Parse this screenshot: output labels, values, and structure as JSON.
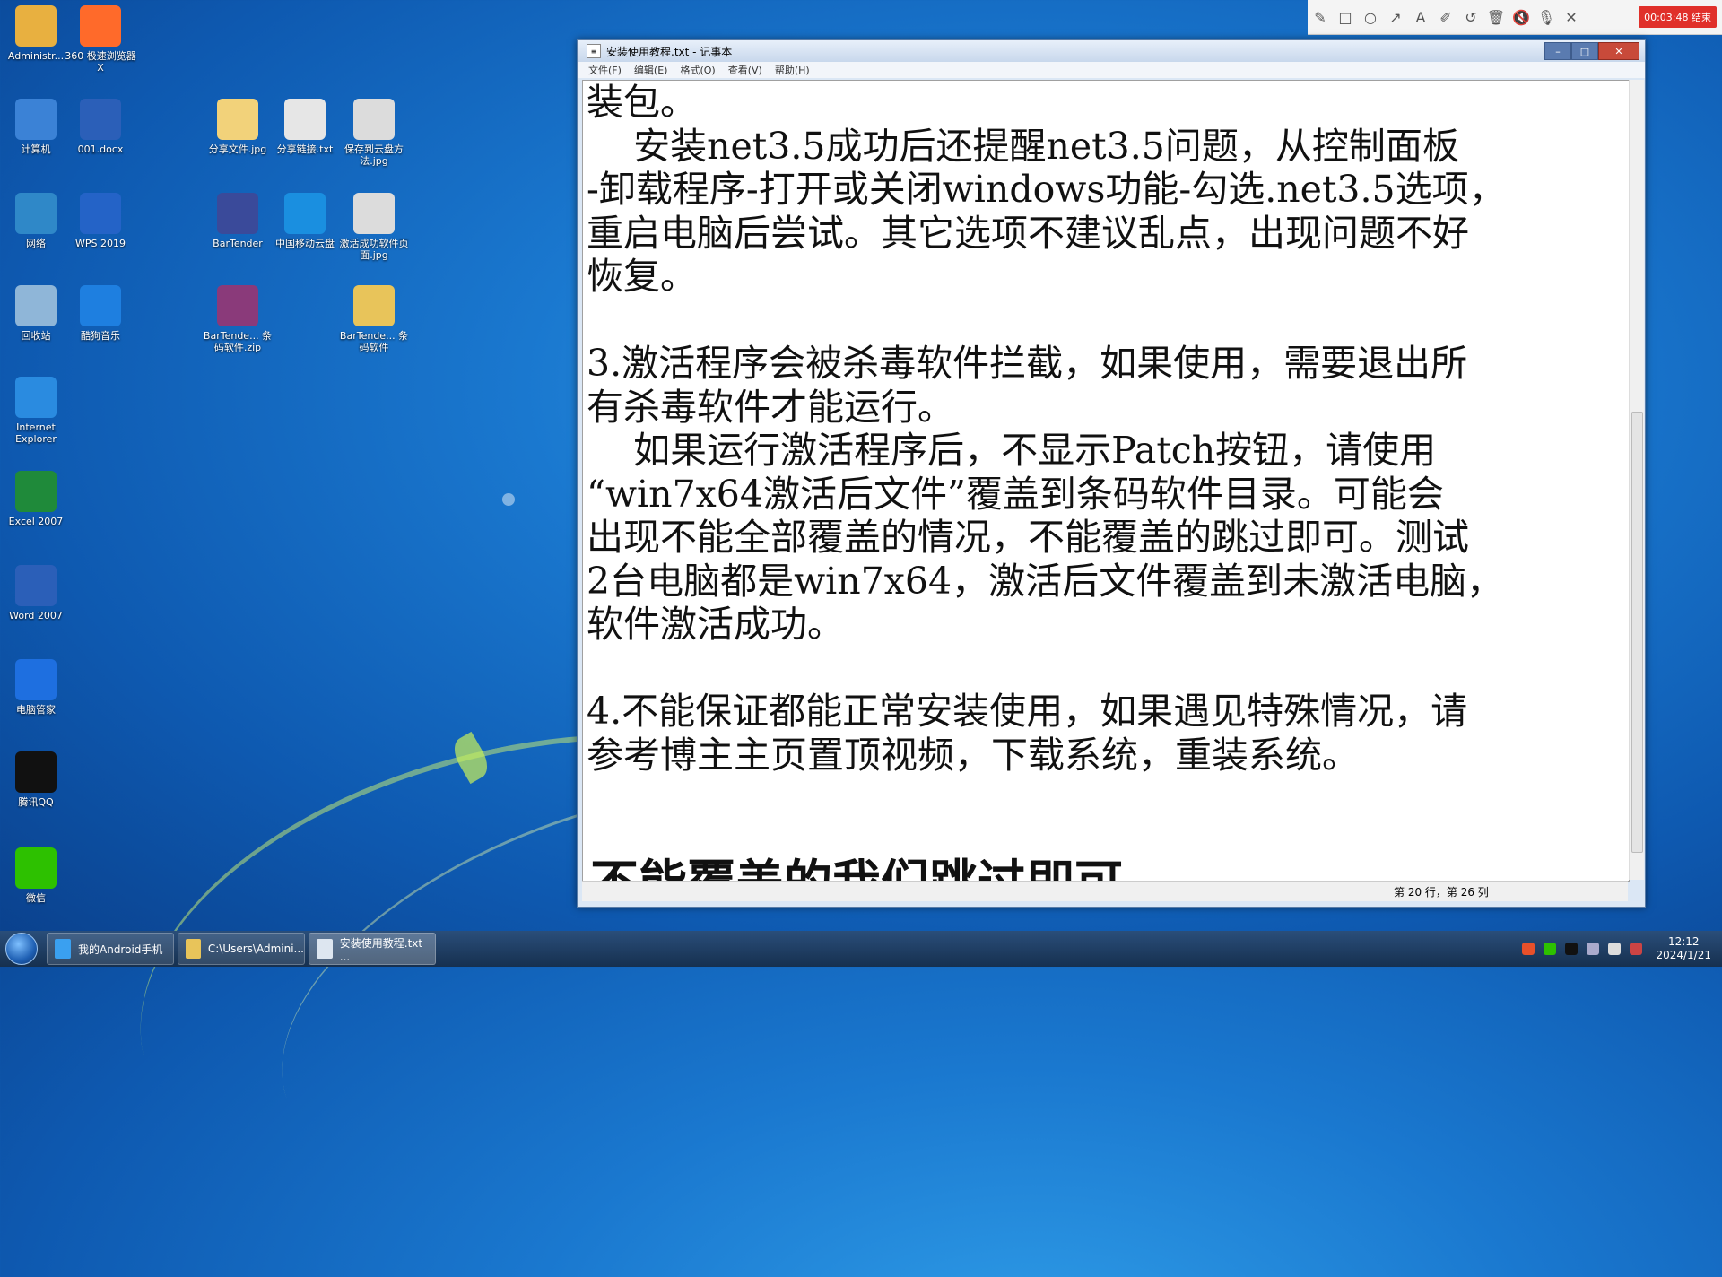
{
  "desktop": {
    "icons": [
      {
        "label": "Administr...",
        "icon": "folder-icon",
        "color": "#e8b040"
      },
      {
        "label": "360 极速浏览器X",
        "icon": "browser-360-icon",
        "color": "#ff6a2a"
      },
      {
        "label": "计算机",
        "icon": "computer-icon",
        "color": "#3b82d6"
      },
      {
        "label": "001.docx",
        "icon": "word-doc-icon",
        "color": "#2b5fb8"
      },
      {
        "label": "分享文件.jpg",
        "icon": "image-file-icon",
        "color": "#f2d27a"
      },
      {
        "label": "分享链接.txt",
        "icon": "text-file-icon",
        "color": "#e6e6e6"
      },
      {
        "label": "保存到云盘方法.jpg",
        "icon": "image-file-icon",
        "color": "#dcdcdc"
      },
      {
        "label": "网络",
        "icon": "network-icon",
        "color": "#2f88c8"
      },
      {
        "label": "WPS 2019",
        "icon": "wps-icon",
        "color": "#2463c7"
      },
      {
        "label": "BarTender",
        "icon": "bartender-icon",
        "color": "#3a4a9a"
      },
      {
        "label": "中国移动云盘",
        "icon": "cloud-drive-icon",
        "color": "#1a8fe0"
      },
      {
        "label": "激活成功软件页面.jpg",
        "icon": "image-file-icon",
        "color": "#dcdcdc"
      },
      {
        "label": "回收站",
        "icon": "recycle-bin-icon",
        "color": "#8fb6d8"
      },
      {
        "label": "酷狗音乐",
        "icon": "kugou-icon",
        "color": "#1e7fe0"
      },
      {
        "label": "BarTende... 条码软件.zip",
        "icon": "archive-icon",
        "color": "#8a3a7a"
      },
      {
        "label": "BarTende... 条码软件",
        "icon": "folder-icon",
        "color": "#e8c45a"
      },
      {
        "label": "Internet Explorer",
        "icon": "ie-icon",
        "color": "#2a8be0"
      },
      {
        "label": "Excel 2007",
        "icon": "excel-icon",
        "color": "#1f8a3a"
      },
      {
        "label": "Word 2007",
        "icon": "word-icon",
        "color": "#2b5fb8"
      },
      {
        "label": "电脑管家",
        "icon": "pc-manager-icon",
        "color": "#1e6fe0"
      },
      {
        "label": "腾讯QQ",
        "icon": "qq-icon",
        "color": "#111111"
      },
      {
        "label": "微信",
        "icon": "wechat-icon",
        "color": "#2dc100"
      }
    ]
  },
  "recorder": {
    "timer": "00:03:48 结束",
    "tools": [
      "pencil-icon",
      "rectangle-icon",
      "circle-icon",
      "arrow-icon",
      "text-icon",
      "highlighter-icon",
      "undo-icon",
      "trash-icon",
      "mute-icon",
      "mic-off-icon",
      "close-icon"
    ]
  },
  "notepad": {
    "title": "安装使用教程.txt - 记事本",
    "menu": [
      "文件(F)",
      "编辑(E)",
      "格式(O)",
      "查看(V)",
      "帮助(H)"
    ],
    "lines": [
      "装包。",
      "    安装net3.5成功后还提醒net3.5问题，从控制面板",
      "-卸载程序-打开或关闭windows功能-勾选.net3.5选项，",
      "重启电脑后尝试。其它选项不建议乱点，出现问题不好",
      "恢复。",
      "",
      "3.激活程序会被杀毒软件拦截，如果使用，需要退出所",
      "有杀毒软件才能运行。",
      "    如果运行激活程序后，不显示Patch按钮，请使用",
      "“win7x64激活后文件”覆盖到条码软件目录。可能会",
      "出现不能全部覆盖的情况，不能覆盖的跳过即可。测试",
      "2台电脑都是win7x64，激活后文件覆盖到未激活电脑，",
      "软件激活成功。",
      "",
      "4.不能保证都能正常安装使用，如果遇见特殊情况，请",
      "参考博主主页置顶视频，下载系统，重装系统。"
    ],
    "status": "第 20 行，第 26 列"
  },
  "subtitle": "不能覆盖的我们跳过即可",
  "taskbar": {
    "tasks": [
      "我的Android手机",
      "C:\\Users\\Admini...",
      "安装使用教程.txt ..."
    ],
    "time": "12:12",
    "date": "2024/1/21"
  }
}
